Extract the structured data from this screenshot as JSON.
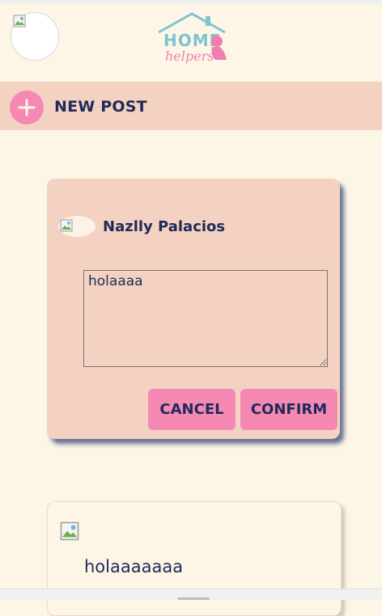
{
  "header": {
    "logo_word_top": "HOME",
    "logo_word_bottom": "helpers"
  },
  "toolbar": {
    "new_post_label": "NEW POST"
  },
  "edit_post": {
    "author_name": "Nazlly Palacios",
    "textarea_value": "holaaaa",
    "cancel_label": "CANCEL",
    "confirm_label": "CONFIRM"
  },
  "posts": [
    {
      "text": "holaaaaaaa"
    }
  ],
  "colors": {
    "background": "#fdf6e6",
    "peach": "#f3d2c1",
    "pink": "#f589b4",
    "navy": "#1f2a5a",
    "teal_logo": "#7fc3cf"
  }
}
